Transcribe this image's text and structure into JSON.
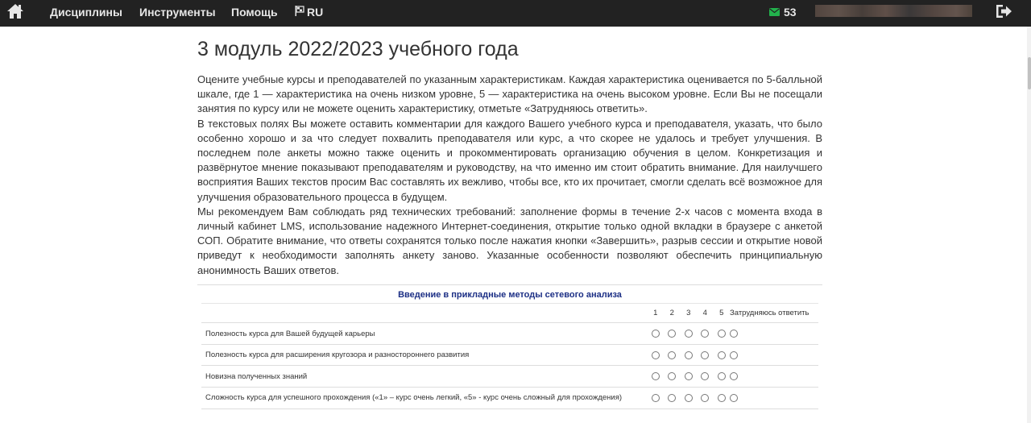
{
  "nav": {
    "items": [
      "Дисциплины",
      "Инструменты",
      "Помощь"
    ],
    "lang": "RU",
    "messages_count": "53",
    "icons": {
      "home": "home-icon",
      "language": "flag-icon",
      "messages": "envelope-icon",
      "logout": "logout-icon"
    },
    "colors": {
      "bar": "#222222",
      "text": "#e6e6e6",
      "envelope": "#22b14c"
    }
  },
  "page": {
    "title": "3 модуль 2022/2023 учебного года",
    "paragraphs": [
      "Оцените учебные курсы и преподавателей по указанным характеристикам. Каждая характеристика оценивается по 5-балльной шкале, где 1 — характеристика на очень низком уровне, 5 — характеристика на очень высоком уровне. Если Вы не посещали занятия по курсу или не можете оценить характеристику, отметьте «Затрудняюсь ответить».",
      "В текстовых полях Вы можете оставить комментарии для каждого Вашего учебного курса и преподавателя, указать, что было особенно хорошо и за что следует похвалить преподавателя или курс, а что скорее не удалось и требует улучшения. В последнем поле анкеты можно также оценить и прокомментировать организацию обучения в целом. Конкретизация и развёрнутое мнение показывают преподавателям и руководству, на что именно им стоит обратить внимание. Для наилучшего восприятия Ваших текстов просим Вас составлять их вежливо, чтобы все, кто их прочитает, смогли сделать всё возможное для улучшения образовательного процесса в будущем.",
      "Мы рекомендуем Вам соблюдать ряд технических требований: заполнение формы в течение 2-х часов с момента входа в личный кабинет LMS, использование надежного Интернет-соединения, открытие только одной вкладки в браузере с анкетой СОП. Обратите внимание, что ответы сохранятся только после нажатия кнопки «Завершить», разрыв сессии и открытие новой приведут к необходимости заполнять анкету заново. Указанные особенности позволяют обеспечить принципиальную анонимность Ваших ответов."
    ]
  },
  "course": {
    "title": "Введение в прикладные методы сетевого анализа",
    "scale": [
      "1",
      "2",
      "3",
      "4",
      "5",
      "Затрудняюсь ответить"
    ],
    "criteria": [
      "Полезность курса для Вашей будущей карьеры",
      "Полезность курса для расширения кругозора и разностороннего развития",
      "Новизна полученных знаний",
      "Сложность курса для успешного прохождения («1» – курс очень легкий, «5» - курс очень сложный для прохождения)"
    ],
    "colors": {
      "title": "#1c2f85"
    }
  }
}
